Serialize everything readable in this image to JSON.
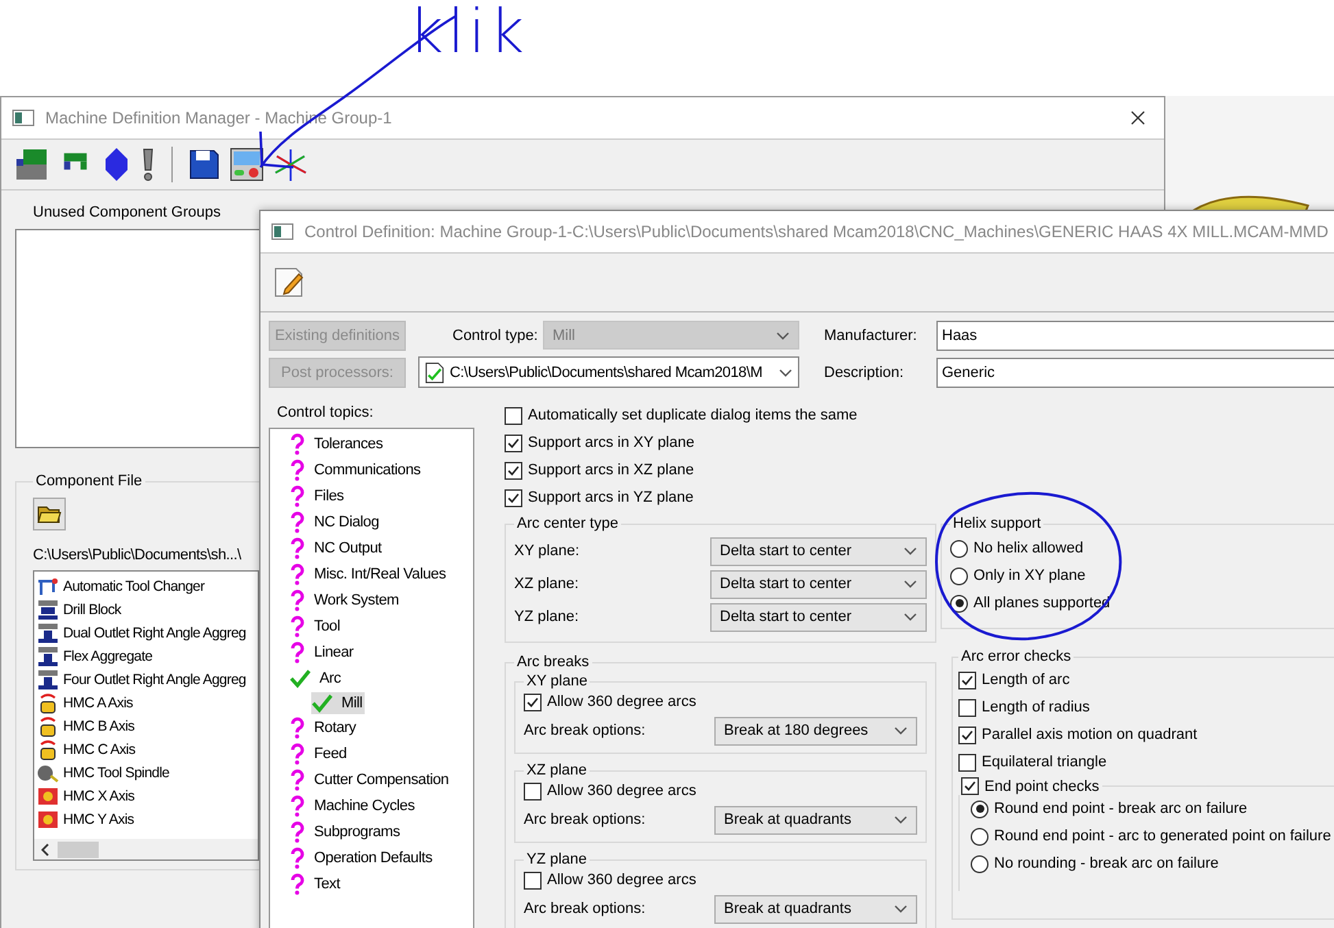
{
  "annotation": {
    "text": "klik"
  },
  "manager_window": {
    "title": "Machine Definition Manager - Machine Group-1",
    "unused_groups": {
      "label": "Unused Component Groups"
    },
    "component_file": {
      "label": "Component File",
      "path": "C:\\Users\\Public\\Documents\\sh...\\",
      "items": [
        {
          "label": "Automatic Tool Changer",
          "kind": "changer"
        },
        {
          "label": "Drill Block",
          "kind": "block"
        },
        {
          "label": "Dual Outlet Right Angle Aggreg",
          "kind": "aggregate"
        },
        {
          "label": "Flex Aggregate",
          "kind": "aggregate"
        },
        {
          "label": "Four Outlet Right Angle Aggreg",
          "kind": "aggregate"
        },
        {
          "label": "HMC A Axis",
          "kind": "rotary"
        },
        {
          "label": "HMC B Axis",
          "kind": "rotary"
        },
        {
          "label": "HMC C Axis",
          "kind": "rotary"
        },
        {
          "label": "HMC Tool Spindle",
          "kind": "spindle"
        },
        {
          "label": "HMC X Axis",
          "kind": "linear"
        },
        {
          "label": "HMC Y Axis",
          "kind": "linear"
        }
      ]
    }
  },
  "control_dialog": {
    "title": "Control Definition: Machine Group-1-C:\\Users\\Public\\Documents\\shared Mcam2018\\CNC_Machines\\GENERIC HAAS 4X MILL.MCAM-MMD",
    "buttons": [
      {
        "label": "Existing definitions",
        "disabled": true
      },
      {
        "label": "Post processors:",
        "disabled": true
      }
    ],
    "control_type": {
      "label": "Control type:",
      "value": "Mill",
      "disabled": true
    },
    "post_path": "C:\\Users\\Public\\Documents\\shared Mcam2018\\M",
    "manufacturer": {
      "label": "Manufacturer:",
      "value": "Haas"
    },
    "description": {
      "label": "Description:",
      "value": "Generic"
    },
    "topics": {
      "label": "Control topics:",
      "items": [
        {
          "label": "Tolerances",
          "kind": "unset",
          "selected": false
        },
        {
          "label": "Communications",
          "kind": "unset",
          "selected": false
        },
        {
          "label": "Files",
          "kind": "unset",
          "selected": false
        },
        {
          "label": "NC Dialog",
          "kind": "unset",
          "selected": false
        },
        {
          "label": "NC Output",
          "kind": "unset",
          "selected": false
        },
        {
          "label": "Misc. Int/Real Values",
          "kind": "unset",
          "selected": false
        },
        {
          "label": "Work System",
          "kind": "unset",
          "selected": false
        },
        {
          "label": "Tool",
          "kind": "unset",
          "selected": false
        },
        {
          "label": "Linear",
          "kind": "unset",
          "selected": false
        },
        {
          "label": "Arc",
          "kind": "done",
          "selected": false,
          "children": [
            {
              "label": "Mill",
              "kind": "done",
              "selected": true
            }
          ]
        },
        {
          "label": "Rotary",
          "kind": "unset",
          "selected": false
        },
        {
          "label": "Feed",
          "kind": "unset",
          "selected": false
        },
        {
          "label": "Cutter Compensation",
          "kind": "unset",
          "selected": false
        },
        {
          "label": "Machine Cycles",
          "kind": "unset",
          "selected": false
        },
        {
          "label": "Subprograms",
          "kind": "unset",
          "selected": false
        },
        {
          "label": "Operation Defaults",
          "kind": "unset",
          "selected": false
        },
        {
          "label": "Text",
          "kind": "unset",
          "selected": false
        }
      ]
    },
    "options": [
      {
        "label": "Automatically set duplicate dialog items the same",
        "checked": false
      },
      {
        "label": "Support arcs in XY plane",
        "checked": true
      },
      {
        "label": "Support arcs in XZ plane",
        "checked": true
      },
      {
        "label": "Support arcs in YZ plane",
        "checked": true
      }
    ],
    "arc_center_type": {
      "title": "Arc center type",
      "rows": [
        {
          "label": "XY plane:",
          "value": "Delta start to center"
        },
        {
          "label": "XZ plane:",
          "value": "Delta start to center"
        },
        {
          "label": "YZ plane:",
          "value": "Delta start to center"
        }
      ]
    },
    "helix_support": {
      "title": "Helix support",
      "options": [
        {
          "label": "No helix allowed",
          "selected": false
        },
        {
          "label": "Only in XY plane",
          "selected": false
        },
        {
          "label": "All planes supported",
          "selected": true
        }
      ]
    },
    "arc_breaks": {
      "title": "Arc breaks",
      "planes": [
        {
          "title": "XY plane",
          "allow": {
            "label": "Allow 360 degree arcs",
            "checked": true
          },
          "options_label": "Arc break options:",
          "value": "Break at 180 degrees"
        },
        {
          "title": "XZ plane",
          "allow": {
            "label": "Allow 360 degree arcs",
            "checked": false
          },
          "options_label": "Arc break options:",
          "value": "Break at quadrants"
        },
        {
          "title": "YZ plane",
          "allow": {
            "label": "Allow 360 degree arcs",
            "checked": false
          },
          "options_label": "Arc break options:",
          "value": "Break at quadrants"
        }
      ]
    },
    "arc_error_checks": {
      "title": "Arc error checks",
      "checks": [
        {
          "label": "Length of arc",
          "checked": true
        },
        {
          "label": "Length of radius",
          "checked": false
        },
        {
          "label": "Parallel axis motion on quadrant",
          "checked": true
        },
        {
          "label": "Equilateral triangle",
          "checked": false
        }
      ],
      "end_point": {
        "label": "End point checks",
        "checked": true,
        "options": [
          {
            "label": "Round end point - break arc on failure",
            "selected": true
          },
          {
            "label": "Round end point - arc to generated point on failure",
            "selected": false
          },
          {
            "label": "No rounding - break arc on failure",
            "selected": false
          }
        ]
      }
    }
  }
}
